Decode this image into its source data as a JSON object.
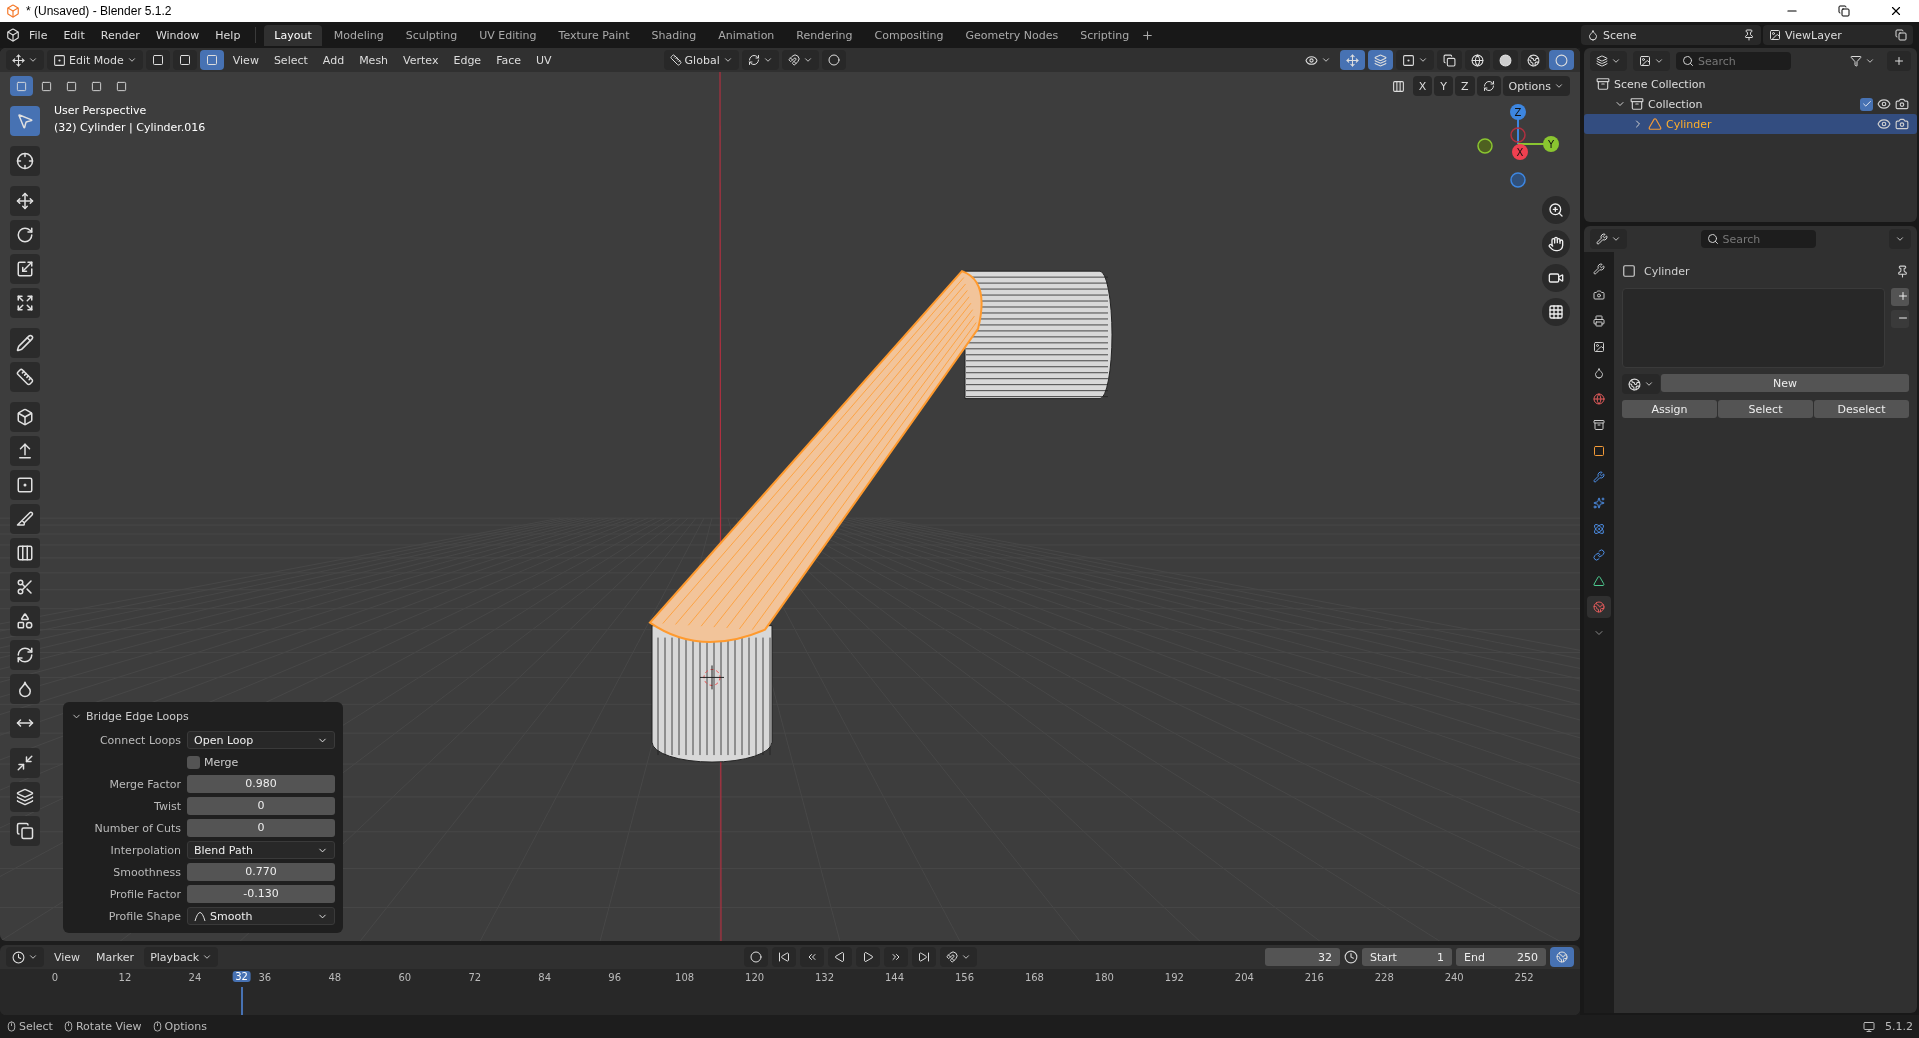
{
  "window": {
    "title": "* (Unsaved) - Blender 5.1.2"
  },
  "menu": [
    "File",
    "Edit",
    "Render",
    "Window",
    "Help"
  ],
  "workspaces": [
    {
      "label": "Layout",
      "selected": true
    },
    {
      "label": "Modeling",
      "selected": false
    },
    {
      "label": "Sculpting",
      "selected": false
    },
    {
      "label": "UV Editing",
      "selected": false
    },
    {
      "label": "Texture Paint",
      "selected": false
    },
    {
      "label": "Shading",
      "selected": false
    },
    {
      "label": "Animation",
      "selected": false
    },
    {
      "label": "Rendering",
      "selected": false
    },
    {
      "label": "Compositing",
      "selected": false
    },
    {
      "label": "Geometry Nodes",
      "selected": false
    },
    {
      "label": "Scripting",
      "selected": false
    }
  ],
  "scene": "Scene",
  "view_layer": "ViewLayer",
  "viewport_header": {
    "mode": "Edit Mode",
    "select_modes": [
      {
        "selected": false
      },
      {
        "selected": false
      },
      {
        "selected": true
      }
    ],
    "menus": [
      "View",
      "Select",
      "Add",
      "Mesh",
      "Vertex",
      "Edge",
      "Face",
      "UV"
    ],
    "orientation": "Global",
    "axes": [
      "X",
      "Y",
      "Z"
    ],
    "options": "Options"
  },
  "viewport": {
    "view_name": "User Perspective",
    "object_info": "(32) Cylinder | Cylinder.016",
    "gizmo_axes": [
      "Z",
      "X",
      "Y"
    ]
  },
  "tools": [
    {
      "selected": true
    },
    {
      "selected": false
    },
    {
      "selected": false
    },
    {
      "selected": false
    },
    {
      "selected": false
    },
    {
      "selected": false
    },
    {
      "selected": false
    },
    {
      "selected": false
    },
    {
      "selected": false
    },
    {
      "selected": false
    },
    {
      "selected": false
    },
    {
      "selected": false
    },
    {
      "selected": false
    },
    {
      "selected": false
    },
    {
      "selected": false
    },
    {
      "selected": false
    },
    {
      "selected": false
    },
    {
      "selected": false
    },
    {
      "selected": false
    },
    {
      "selected": false
    },
    {
      "selected": false
    }
  ],
  "operator_panel": {
    "title": "Bridge Edge Loops",
    "expanded": true,
    "rows": [
      {
        "kind": "dropdown",
        "label": "Connect Loops",
        "value": "Open Loop"
      },
      {
        "kind": "checkbox",
        "label": "Merge",
        "checked": false
      },
      {
        "kind": "number",
        "label": "Merge Factor",
        "value": "0.980"
      },
      {
        "kind": "number",
        "label": "Twist",
        "value": "0"
      },
      {
        "kind": "number",
        "label": "Number of Cuts",
        "value": "0"
      },
      {
        "kind": "dropdown",
        "label": "Interpolation",
        "value": "Blend Path"
      },
      {
        "kind": "number",
        "label": "Smoothness",
        "value": "0.770"
      },
      {
        "kind": "number",
        "label": "Profile Factor",
        "value": "-0.130"
      },
      {
        "kind": "curve_dropdown",
        "label": "Profile Shape",
        "value": "Smooth"
      }
    ]
  },
  "outliner": {
    "search": {
      "placeholder": "Search"
    },
    "items": [
      {
        "label": "Scene Collection",
        "selected": false,
        "children": [
          {
            "label": "Collection",
            "selected": false,
            "expanded": true,
            "checked": true,
            "children": [
              {
                "label": "Cylinder",
                "selected": true,
                "expanded": false
              }
            ]
          }
        ]
      }
    ]
  },
  "properties": {
    "search": {
      "placeholder": "Search"
    },
    "object_name": "Cylinder",
    "new_button": "New",
    "buttons": [
      "Assign",
      "Select",
      "Deselect"
    ],
    "tabs": [
      {
        "selected": false
      },
      {
        "selected": false
      },
      {
        "selected": false
      },
      {
        "selected": false
      },
      {
        "selected": false
      },
      {
        "selected": false
      },
      {
        "selected": false
      },
      {
        "selected": false
      },
      {
        "selected": false
      },
      {
        "selected": false
      },
      {
        "selected": false
      },
      {
        "selected": false
      },
      {
        "selected": false
      },
      {
        "selected": true
      },
      {
        "selected": false
      }
    ]
  },
  "timeline": {
    "menus": [
      {
        "kind": "menu",
        "label": "View"
      },
      {
        "kind": "menu",
        "label": "Marker"
      },
      {
        "kind": "dropdown",
        "label": "Playback"
      }
    ],
    "current_frame": "32",
    "start_label": "Start",
    "start": "1",
    "end_label": "End",
    "end": "250",
    "playhead": "32",
    "ruler": [
      "0",
      "12",
      "24",
      "36",
      "48",
      "60",
      "72",
      "84",
      "96",
      "108",
      "120",
      "132",
      "144",
      "156",
      "168",
      "180",
      "192",
      "204",
      "216",
      "228",
      "240",
      "252"
    ]
  },
  "status_bar": {
    "hints": [
      "Select",
      "Rotate View",
      "Options"
    ],
    "version": "5.1.2"
  }
}
